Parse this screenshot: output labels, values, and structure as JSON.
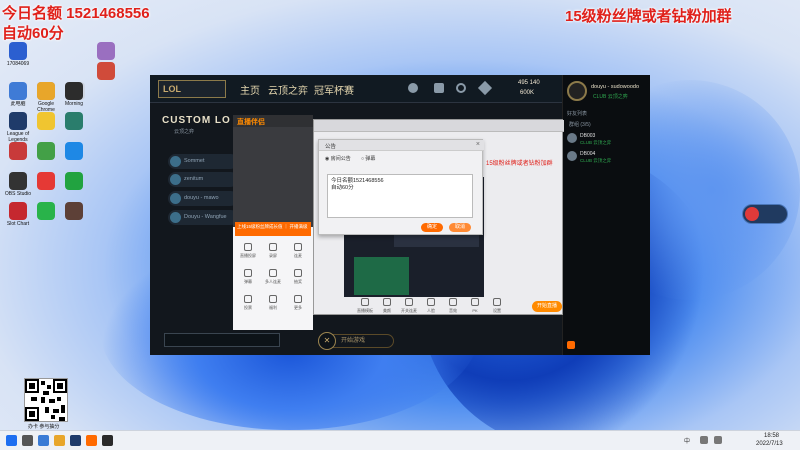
{
  "overlays": {
    "today_text": "今日名额 1521468556",
    "auto_text": "自动60分",
    "right_text": "15级粉丝牌或者钻粉加群",
    "qr_caption": "办卡 参与抽分"
  },
  "desktop_icons": [
    {
      "label": "17084069",
      "color": "#2b5fd0"
    },
    {
      "label": "",
      "color": "#7a8aa0"
    },
    {
      "label": "",
      "color": "#cfd6e2"
    },
    {
      "label": "",
      "color": "#9a6fc0"
    },
    {
      "label": "",
      "color": "#d04b3a"
    },
    {
      "label": "此电脑",
      "color": "#3f7bd6"
    },
    {
      "label": "Google Chrome",
      "color": "#e8a62a"
    },
    {
      "label": "Morning",
      "color": "#2c2c2c"
    },
    {
      "label": "League of Legends",
      "color": "#1f3b6a"
    },
    {
      "label": "",
      "color": "#f0c530"
    },
    {
      "label": "",
      "color": "#2a7d6c"
    },
    {
      "label": "",
      "color": "#c83a3a"
    },
    {
      "label": "",
      "color": "#43a047"
    },
    {
      "label": "",
      "color": "#1e88e5"
    },
    {
      "label": "OBS Studio",
      "color": "#333"
    },
    {
      "label": "",
      "color": "#e53935"
    },
    {
      "label": "",
      "color": "#21a340"
    },
    {
      "label": "Slot Chart",
      "color": "#c5282f"
    },
    {
      "label": "",
      "color": "#29b34a"
    },
    {
      "label": "",
      "color": "#5d4037"
    }
  ],
  "client": {
    "logo": "LOL",
    "nav": [
      "主页",
      "云顶之弈",
      "冠军杯赛"
    ],
    "currency": [
      "495 140",
      "600K"
    ],
    "title": "CUSTOM LO",
    "subtitle": "云顶之弈",
    "rooms": [
      "Sommet",
      "zenitum",
      "douyu - mawo",
      "Douyu - Wangfue"
    ],
    "start_label": "开始游戏",
    "friends_title": "好友列表",
    "friends_header": "群组 (3/5)",
    "friends": [
      {
        "name": "DB003",
        "status": "CLUB 云顶之弈"
      },
      {
        "name": "DB004",
        "status": "CLUB 云顶之弈"
      }
    ],
    "profile_name": "douyu - sudowoodo",
    "profile_status": "CLUB 云顶之弈"
  },
  "live_panel": {
    "title": "直播伴侣",
    "promo": "上线15级粉丝牌成长值 ｜ 开播满级",
    "tools": [
      "直播投屏",
      "录屏",
      "连麦",
      "弹幕",
      "多人连麦",
      "抽奖",
      "投票",
      "福利",
      "更多"
    ]
  },
  "cast_window": {
    "toolbar": [
      "直播模板",
      "美颜",
      "开关连麦",
      "人脸",
      "音效",
      "PK",
      "设置"
    ],
    "start_live": "开始直播",
    "side_note": "15级粉丝牌或者钻粉加群"
  },
  "dialog": {
    "title": "公告",
    "options": [
      "房间公告",
      "弹幕"
    ],
    "content_line1": "今日名额1521468556",
    "content_line2": "自动60分",
    "ok": "确定",
    "cancel": "取消"
  },
  "taskbar": {
    "time": "18:58",
    "date": "2022/7/13",
    "lang": "中"
  }
}
